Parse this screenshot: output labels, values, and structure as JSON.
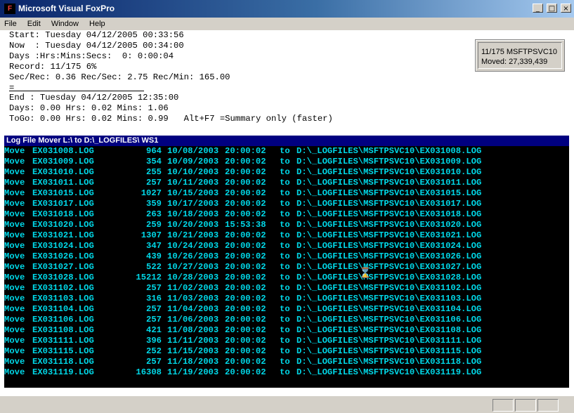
{
  "window": {
    "title": "Microsoft Visual FoxPro",
    "icon": "fox-icon",
    "controls": {
      "minimize": "_",
      "maximize": "□",
      "close": "×"
    }
  },
  "menu": {
    "items": [
      "File",
      "Edit",
      "Window",
      "Help"
    ]
  },
  "status": {
    "lines": [
      "Start: Tuesday 04/12/2005 00:33:56",
      "Now  : Tuesday 04/12/2005 00:34:00",
      "Days :Hrs:Mins:Secs:  0: 0:00:04",
      "Record: 11/175 6%",
      "Sec/Rec: 0.36 Rec/Sec: 2.75 Rec/Min: 165.00",
      "="
    ],
    "lines2": [
      "End : Tuesday 04/12/2005 12:35:00",
      "Days: 0.00 Hrs: 0.02 Mins: 1.06",
      "ToGo: 0.00 Hrs: 0.02 Mins: 0.99   Alt+F7 =Summary only (faster)"
    ]
  },
  "info_box": {
    "line1": "11/175 MSFTPSVC10",
    "line2": "Moved: 27,339,439"
  },
  "log": {
    "title": "Log File Mover L:\\ to D:\\_LOGFILES\\ WS1",
    "rows": [
      {
        "action": "Move",
        "file": "EX031008.LOG",
        "size": "964",
        "date": "10/08/2003",
        "time": "20:00:02",
        "to": "to",
        "dest": "D:\\_LOGFILES\\MSFTPSVC10\\EX031008.LOG"
      },
      {
        "action": "Move",
        "file": "EX031009.LOG",
        "size": "354",
        "date": "10/09/2003",
        "time": "20:00:02",
        "to": "to",
        "dest": "D:\\_LOGFILES\\MSFTPSVC10\\EX031009.LOG"
      },
      {
        "action": "Move",
        "file": "EX031010.LOG",
        "size": "255",
        "date": "10/10/2003",
        "time": "20:00:02",
        "to": "to",
        "dest": "D:\\_LOGFILES\\MSFTPSVC10\\EX031010.LOG"
      },
      {
        "action": "Move",
        "file": "EX031011.LOG",
        "size": "257",
        "date": "10/11/2003",
        "time": "20:00:02",
        "to": "to",
        "dest": "D:\\_LOGFILES\\MSFTPSVC10\\EX031011.LOG"
      },
      {
        "action": "Move",
        "file": "EX031015.LOG",
        "size": "1027",
        "date": "10/15/2003",
        "time": "20:00:02",
        "to": "to",
        "dest": "D:\\_LOGFILES\\MSFTPSVC10\\EX031015.LOG"
      },
      {
        "action": "Move",
        "file": "EX031017.LOG",
        "size": "359",
        "date": "10/17/2003",
        "time": "20:00:02",
        "to": "to",
        "dest": "D:\\_LOGFILES\\MSFTPSVC10\\EX031017.LOG"
      },
      {
        "action": "Move",
        "file": "EX031018.LOG",
        "size": "263",
        "date": "10/18/2003",
        "time": "20:00:02",
        "to": "to",
        "dest": "D:\\_LOGFILES\\MSFTPSVC10\\EX031018.LOG"
      },
      {
        "action": "Move",
        "file": "EX031020.LOG",
        "size": "259",
        "date": "10/20/2003",
        "time": "15:53:38",
        "to": "to",
        "dest": "D:\\_LOGFILES\\MSFTPSVC10\\EX031020.LOG"
      },
      {
        "action": "Move",
        "file": "EX031021.LOG",
        "size": "1307",
        "date": "10/21/2003",
        "time": "20:00:02",
        "to": "to",
        "dest": "D:\\_LOGFILES\\MSFTPSVC10\\EX031021.LOG"
      },
      {
        "action": "Move",
        "file": "EX031024.LOG",
        "size": "347",
        "date": "10/24/2003",
        "time": "20:00:02",
        "to": "to",
        "dest": "D:\\_LOGFILES\\MSFTPSVC10\\EX031024.LOG"
      },
      {
        "action": "Move",
        "file": "EX031026.LOG",
        "size": "439",
        "date": "10/26/2003",
        "time": "20:00:02",
        "to": "to",
        "dest": "D:\\_LOGFILES\\MSFTPSVC10\\EX031026.LOG"
      },
      {
        "action": "Move",
        "file": "EX031027.LOG",
        "size": "522",
        "date": "10/27/2003",
        "time": "20:00:02",
        "to": "to",
        "dest": "D:\\_LOGFILES\\MSFTPSVC10\\EX031027.LOG"
      },
      {
        "action": "Move",
        "file": "EX031028.LOG",
        "size": "15212",
        "date": "10/28/2003",
        "time": "20:00:02",
        "to": "to",
        "dest": "D:\\_LOGFILES\\MSFTPSVC10\\EX031028.LOG"
      },
      {
        "action": "Move",
        "file": "EX031102.LOG",
        "size": "257",
        "date": "11/02/2003",
        "time": "20:00:02",
        "to": "to",
        "dest": "D:\\_LOGFILES\\MSFTPSVC10\\EX031102.LOG"
      },
      {
        "action": "Move",
        "file": "EX031103.LOG",
        "size": "316",
        "date": "11/03/2003",
        "time": "20:00:02",
        "to": "to",
        "dest": "D:\\_LOGFILES\\MSFTPSVC10\\EX031103.LOG"
      },
      {
        "action": "Move",
        "file": "EX031104.LOG",
        "size": "257",
        "date": "11/04/2003",
        "time": "20:00:02",
        "to": "to",
        "dest": "D:\\_LOGFILES\\MSFTPSVC10\\EX031104.LOG"
      },
      {
        "action": "Move",
        "file": "EX031106.LOG",
        "size": "257",
        "date": "11/06/2003",
        "time": "20:00:02",
        "to": "to",
        "dest": "D:\\_LOGFILES\\MSFTPSVC10\\EX031106.LOG"
      },
      {
        "action": "Move",
        "file": "EX031108.LOG",
        "size": "421",
        "date": "11/08/2003",
        "time": "20:00:02",
        "to": "to",
        "dest": "D:\\_LOGFILES\\MSFTPSVC10\\EX031108.LOG"
      },
      {
        "action": "Move",
        "file": "EX031111.LOG",
        "size": "396",
        "date": "11/11/2003",
        "time": "20:00:02",
        "to": "to",
        "dest": "D:\\_LOGFILES\\MSFTPSVC10\\EX031111.LOG"
      },
      {
        "action": "Move",
        "file": "EX031115.LOG",
        "size": "252",
        "date": "11/15/2003",
        "time": "20:00:02",
        "to": "to",
        "dest": "D:\\_LOGFILES\\MSFTPSVC10\\EX031115.LOG"
      },
      {
        "action": "Move",
        "file": "EX031118.LOG",
        "size": "257",
        "date": "11/18/2003",
        "time": "20:00:02",
        "to": "to",
        "dest": "D:\\_LOGFILES\\MSFTPSVC10\\EX031118.LOG"
      },
      {
        "action": "Move",
        "file": "EX031119.LOG",
        "size": "16308",
        "date": "11/19/2003",
        "time": "20:00:02",
        "to": "to",
        "dest": "D:\\_LOGFILES\\MSFTPSVC10\\EX031119.LOG"
      }
    ]
  },
  "colors": {
    "title_bar": "#0a246a",
    "log_text": "#00d8e8",
    "log_background": "#000000",
    "log_title_bar": "#000080"
  },
  "cursor": {
    "icon": "hourglass-icon",
    "glyph": "⌛"
  }
}
